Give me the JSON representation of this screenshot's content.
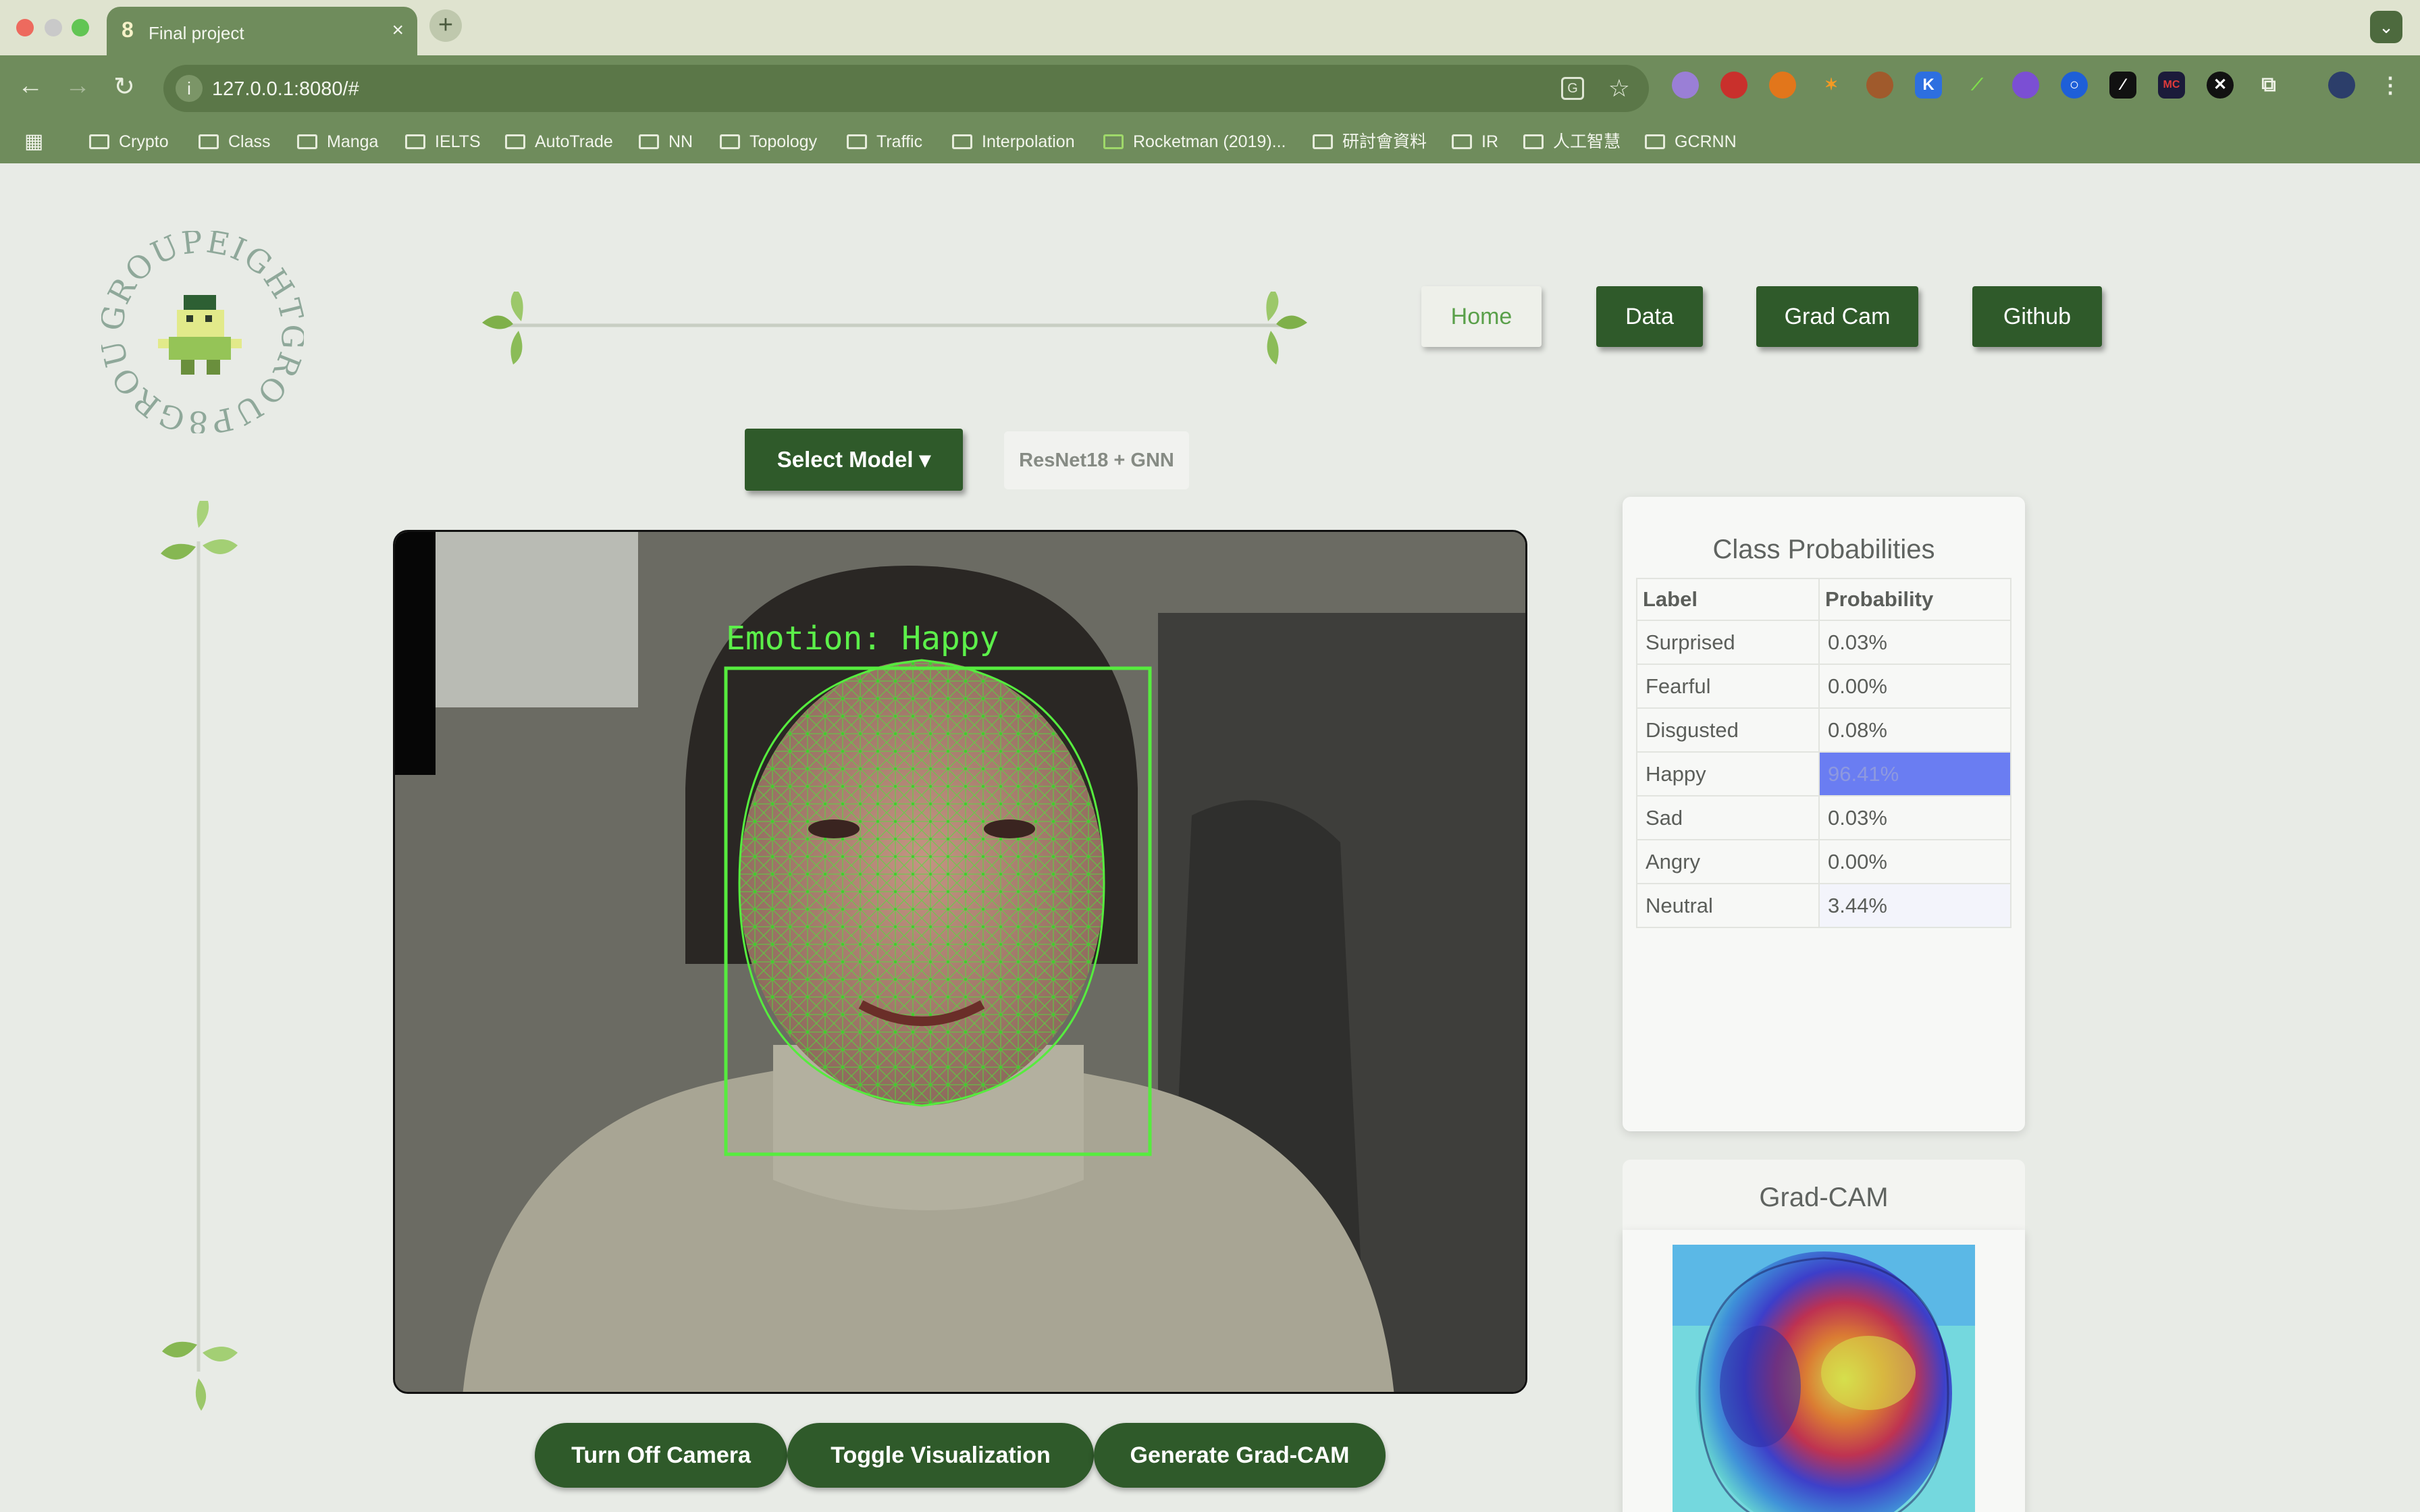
{
  "browser": {
    "tab_title": "Final project",
    "tab_favicon": "8",
    "close_icon": "×",
    "new_tab_icon": "+",
    "url": "127.0.0.1:8080/#",
    "bookmarks": [
      "Crypto",
      "Class",
      "Manga",
      "IELTS",
      "AutoTrade",
      "NN",
      "Topology",
      "Traffic",
      "Interpolation",
      "Rocketman (2019)...",
      "研討會資料",
      "IR",
      "人工智慧",
      "GCRNN"
    ],
    "extension_letters": {
      "k": "K",
      "mc": "MC"
    }
  },
  "logo": {
    "text": "GROUPEIGHTGROUP8GROUP8"
  },
  "nav": {
    "home": "Home",
    "data": "Data",
    "gradcam": "Grad Cam",
    "github": "Github"
  },
  "model": {
    "select_label": "Select Model ▾",
    "current": "ResNet18 + GNN"
  },
  "video": {
    "emotion_label": "Emotion: Happy"
  },
  "probabilities": {
    "title": "Class Probabilities",
    "headers": {
      "label": "Label",
      "probability": "Probability"
    },
    "rows": [
      {
        "label": "Surprised",
        "value": "0.03%"
      },
      {
        "label": "Fearful",
        "value": "0.00%"
      },
      {
        "label": "Disgusted",
        "value": "0.08%"
      },
      {
        "label": "Happy",
        "value": "96.41%"
      },
      {
        "label": "Sad",
        "value": "0.03%"
      },
      {
        "label": "Angry",
        "value": "0.00%"
      },
      {
        "label": "Neutral",
        "value": "3.44%"
      }
    ],
    "highlight_color": "#6a7df2"
  },
  "gradcam": {
    "title": "Grad-CAM"
  },
  "controls": {
    "camera": "Turn Off Camera",
    "toggle": "Toggle Visualization",
    "generate": "Generate Grad-CAM"
  },
  "colors": {
    "accent": "#2f5a2a",
    "chrome": "#6f8c5c",
    "landmark": "#5cf04a"
  }
}
